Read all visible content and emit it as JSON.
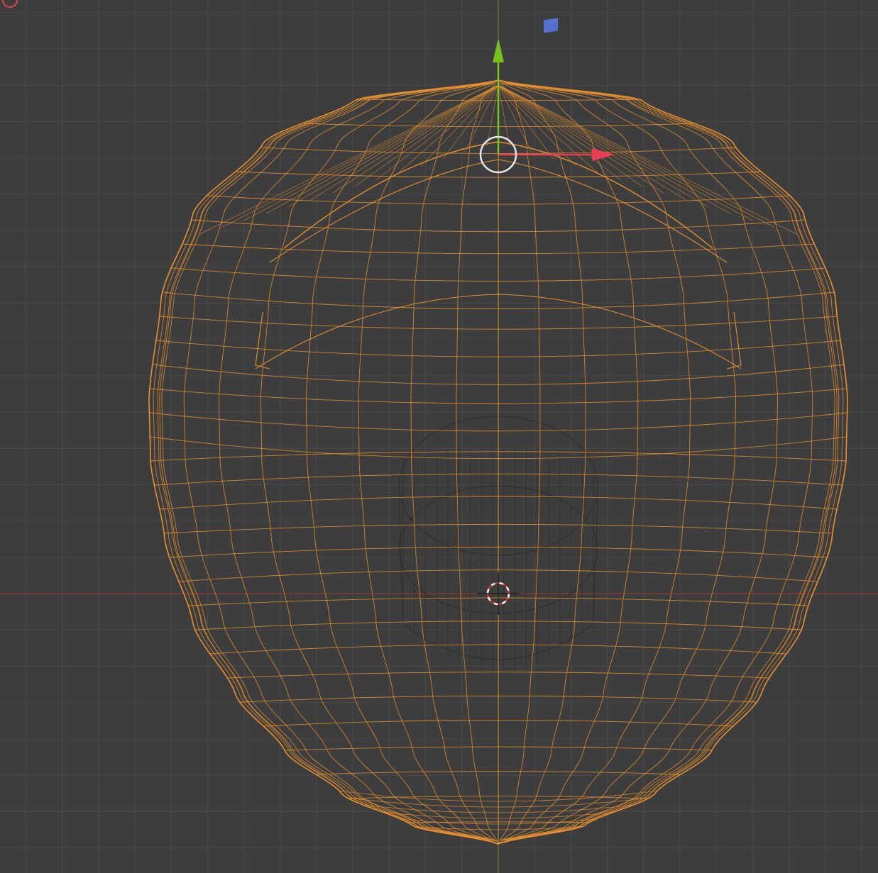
{
  "viewport": {
    "background": "#3d3d3d",
    "grid_minor_color": "#4a4a4a",
    "grid_major_color": "#505050",
    "axis_x_color": "#8a3a3a",
    "axis_y_color": "#5c7a2e",
    "mesh_color": "#e89030",
    "inner_mesh_color": "#2b2b2b"
  },
  "gizmo": {
    "x_axis_color": "#e83e56",
    "y_axis_color": "#76c020",
    "z_axis_color": "#5577dd",
    "pivot_ring_color": "#e6e6e6"
  },
  "cursor_3d": {
    "primary_color": "#ffffff",
    "secondary_color": "#d03030"
  },
  "icons": [
    "3d-cursor-icon",
    "transform-gizmo-icon",
    "navigation-gizmo-icon"
  ]
}
